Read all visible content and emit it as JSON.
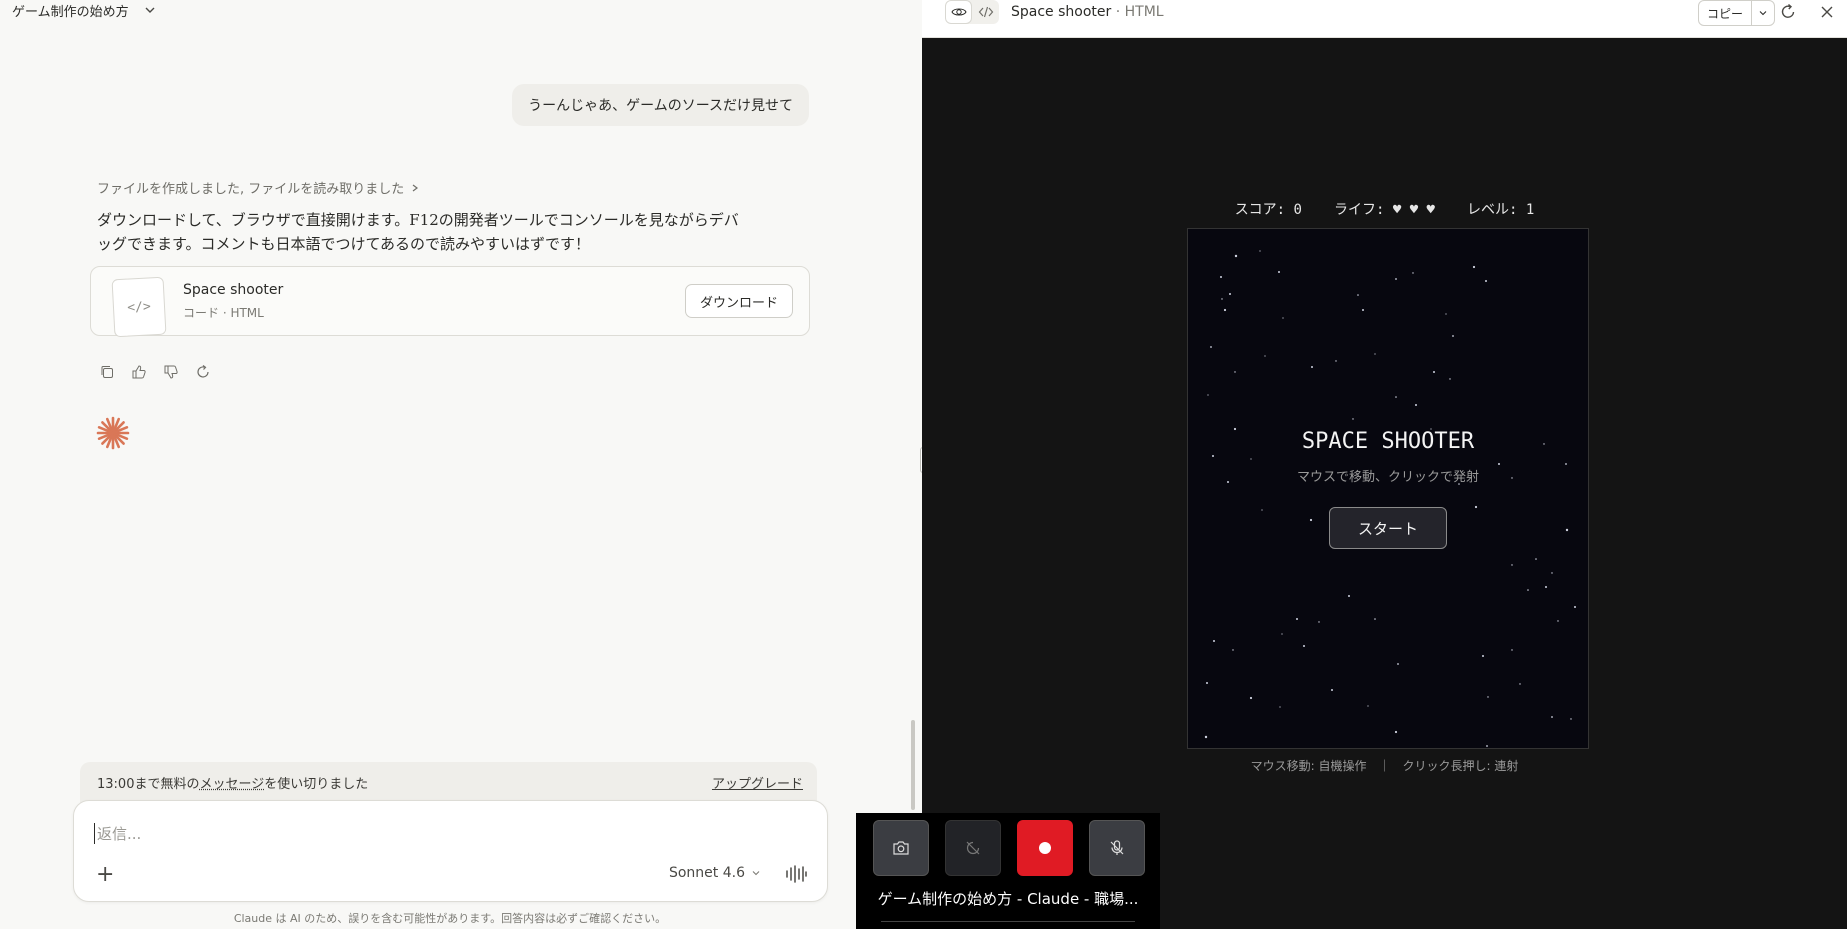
{
  "conversation": {
    "title": "ゲーム制作の始め方",
    "user_message": "うーんじゃあ、ゲームのソースだけ見せて",
    "tools_line": "ファイルを作成しました, ファイルを読み取りました",
    "reply_line1": "ダウンロードして、ブラウザで直接開けます。F12の開発者ツールでコンソールを見ながらデバ",
    "reply_line2": "ッグできます。コメントも日本語でつけてあるので読みやすいはずです！",
    "artifact": {
      "name": "Space shooter",
      "meta": "コード · HTML",
      "thumb_glyph": "</>",
      "download_label": "ダウンロード"
    }
  },
  "limit_bar": {
    "text_before": "13:00まで無料の",
    "text_link": "メッセージ",
    "text_after": "を使い切りました",
    "upgrade_label": "アップグレード"
  },
  "composer": {
    "placeholder": "返信...",
    "plus_label": "+",
    "model_label": "Sonnet 4.6"
  },
  "disclaimer": "Claude は AI のため、誤りを含む可能性があります。回答内容は必ずご確認ください。",
  "preview": {
    "title": "Space shooter",
    "subtitle": " · HTML",
    "copy_label": "コピー"
  },
  "game": {
    "score": "スコア: 0",
    "lives": "ライフ: ♥ ♥ ♥",
    "level": "レベル: 1",
    "heading": "SPACE SHOOTER",
    "subheading": "マウスで移動、クリックで発射",
    "start_label": "スタート",
    "help": "マウス移動: 自機操作　｜　クリック長押し: 連射"
  },
  "recorder": {
    "caption": "ゲーム制作の始め方 - Claude - 職場...",
    "colors": {
      "record": "#e01b24",
      "button": "#3b3d42"
    }
  },
  "colors": {
    "accent": "#d97757",
    "game_bg": "#07070f",
    "panel_bg": "#141414"
  }
}
